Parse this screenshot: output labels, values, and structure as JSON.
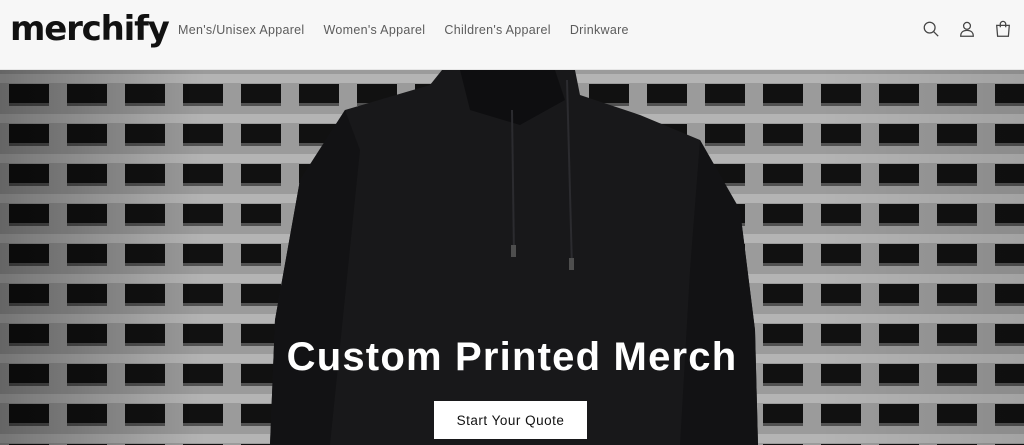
{
  "brand": {
    "name": "merchify"
  },
  "nav": {
    "items": [
      {
        "label": "Men's/Unisex Apparel"
      },
      {
        "label": "Women's Apparel"
      },
      {
        "label": "Children's Apparel"
      },
      {
        "label": "Drinkware"
      }
    ]
  },
  "header_icons": [
    "search-icon",
    "account-icon",
    "cart-icon"
  ],
  "hero": {
    "title": "Custom Printed Merch",
    "cta_label": "Start Your Quote",
    "image": "person-in-black-hoodie-against-shutter-wall"
  },
  "colors": {
    "header_bg": "#f7f7f7",
    "text": "#121212",
    "nav_text": "#5c5c5c",
    "hero_text": "#ffffff",
    "cta_bg": "#ffffff"
  }
}
